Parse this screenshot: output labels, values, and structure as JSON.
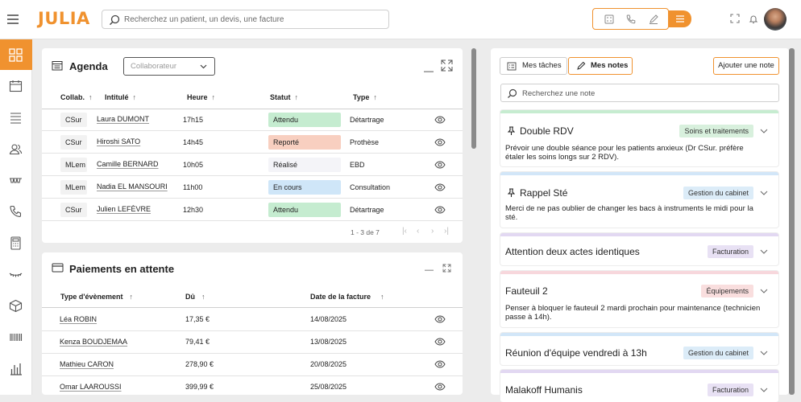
{
  "app": {
    "logo": "JULIA"
  },
  "topbar": {
    "search_placeholder": "Recherchez un patient, un devis, une facture"
  },
  "colors": {
    "accent": "#f0922f",
    "attendu": "#c5ecd0",
    "reporte": "#f8cfc0",
    "realise": "#f4f4f8",
    "en_cours": "#cfe6f8"
  },
  "icons": {
    "menu": "hamburger-icon",
    "search": "search-icon",
    "notifications": "bell-icon",
    "expand": "expand-icon"
  },
  "agenda": {
    "title": "Agenda",
    "collab_placeholder": "Collaborateur",
    "minimize": "—",
    "headers": [
      "Collab.",
      "Intitulé",
      "Heure",
      "Statut",
      "Type"
    ],
    "rows": [
      {
        "collab": "CSur",
        "intitule": "Laura DUMONT",
        "heure": "17h15",
        "statut": "Attendu",
        "status_key": "attendu",
        "type": "Détartrage"
      },
      {
        "collab": "CSur",
        "intitule": "Hiroshi SATO",
        "heure": "14h45",
        "statut": "Reporté",
        "status_key": "reporte",
        "type": "Prothèse"
      },
      {
        "collab": "MLem",
        "intitule": "Camille BERNARD",
        "heure": "10h05",
        "statut": "Réalisé",
        "status_key": "realise",
        "type": "EBD"
      },
      {
        "collab": "MLem",
        "intitule": "Nadia EL MANSOURI",
        "heure": "11h00",
        "statut": "En cours",
        "status_key": "en_cours",
        "type": "Consultation"
      },
      {
        "collab": "CSur",
        "intitule": "Julien LEFÈVRE",
        "heure": "12h30",
        "statut": "Attendu",
        "status_key": "attendu",
        "type": "Détartrage"
      }
    ],
    "pagination": "1 - 3 de 7"
  },
  "paiements": {
    "title": "Paiements en attente",
    "minimize": "—",
    "headers": [
      "Type d'évènement",
      "Dû",
      "Date de la facture"
    ],
    "rows": [
      {
        "name": "Léa ROBIN",
        "du": "17,35 €",
        "date": "14/08/2025"
      },
      {
        "name": "Kenza BOUDJEMAA",
        "du": "79,41 €",
        "date": "13/08/2025"
      },
      {
        "name": "Mathieu CARON",
        "du": "278,90 €",
        "date": "20/08/2025"
      },
      {
        "name": "Omar LAAROUSSI",
        "du": "399,99 €",
        "date": "25/08/2025"
      }
    ]
  },
  "notes": {
    "tabs": [
      "Mes tâches",
      "Mes notes"
    ],
    "active_tab": "Mes notes",
    "add_button": "Ajouter une note",
    "search_placeholder": "Recherchez une note",
    "items": [
      {
        "title": "Double RDV",
        "pinned": true,
        "badge": "Soins et traitements",
        "badge_color": "#d8f0dd",
        "bar_color": "#c6ecd0",
        "text": "Prévoir une double séance pour les patients anxieux (Dr CSur. préfère étaler les soins longs sur 2 RDV)."
      },
      {
        "title": "Rappel Sté",
        "pinned": true,
        "badge": "Gestion du cabinet",
        "badge_color": "#dcecf8",
        "bar_color": "#d2e6f8",
        "text": "Merci de ne pas oublier de changer les bacs à instruments le midi pour la sté."
      },
      {
        "title": "Attention deux actes identiques",
        "pinned": false,
        "badge": "Facturation",
        "badge_color": "#e8e1f4",
        "bar_color": "#e2d8f2",
        "text": ""
      },
      {
        "title": "Fauteuil 2",
        "pinned": false,
        "badge": "Équipements",
        "badge_color": "#f9dede",
        "bar_color": "#f7d7dc",
        "text": "Penser à bloquer le fauteuil 2 mardi prochain pour maintenance (technicien passe à 14h)."
      },
      {
        "title": "Réunion d'équipe vendredi à 13h",
        "pinned": false,
        "badge": "Gestion du cabinet",
        "badge_color": "#dcecf8",
        "bar_color": "#d2e6f8",
        "text": ""
      },
      {
        "title": "Malakoff Humanis",
        "pinned": false,
        "badge": "Facturation",
        "badge_color": "#e8e1f4",
        "bar_color": "#e2d8f2",
        "text": ""
      }
    ]
  }
}
